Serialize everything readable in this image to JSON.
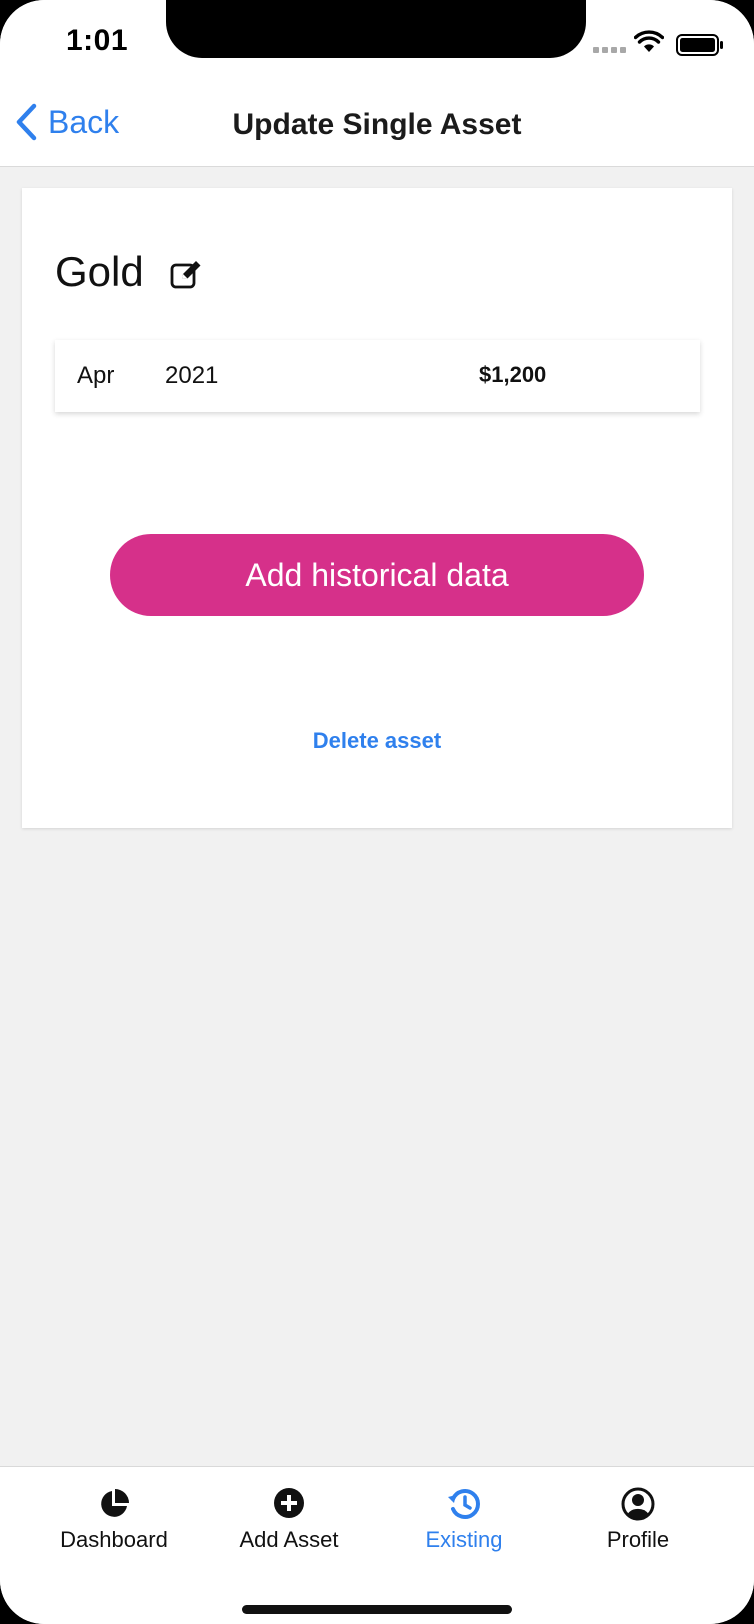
{
  "status_bar": {
    "time": "1:01"
  },
  "nav": {
    "back_label": "Back",
    "title": "Update Single Asset"
  },
  "asset": {
    "name": "Gold",
    "history": [
      {
        "month": "Apr",
        "year": "2021",
        "value": "$1,200"
      }
    ]
  },
  "actions": {
    "add_label": "Add historical data",
    "delete_label": "Delete asset"
  },
  "tabs": [
    {
      "label": "Dashboard",
      "icon": "pie-chart-icon",
      "active": false
    },
    {
      "label": "Add Asset",
      "icon": "add-circle-icon",
      "active": false
    },
    {
      "label": "Existing",
      "icon": "history-icon",
      "active": true
    },
    {
      "label": "Profile",
      "icon": "user-circle-icon",
      "active": false
    }
  ],
  "colors": {
    "accent": "#2f80ed",
    "primary_button": "#d6308a",
    "background": "#f1f1f1"
  }
}
